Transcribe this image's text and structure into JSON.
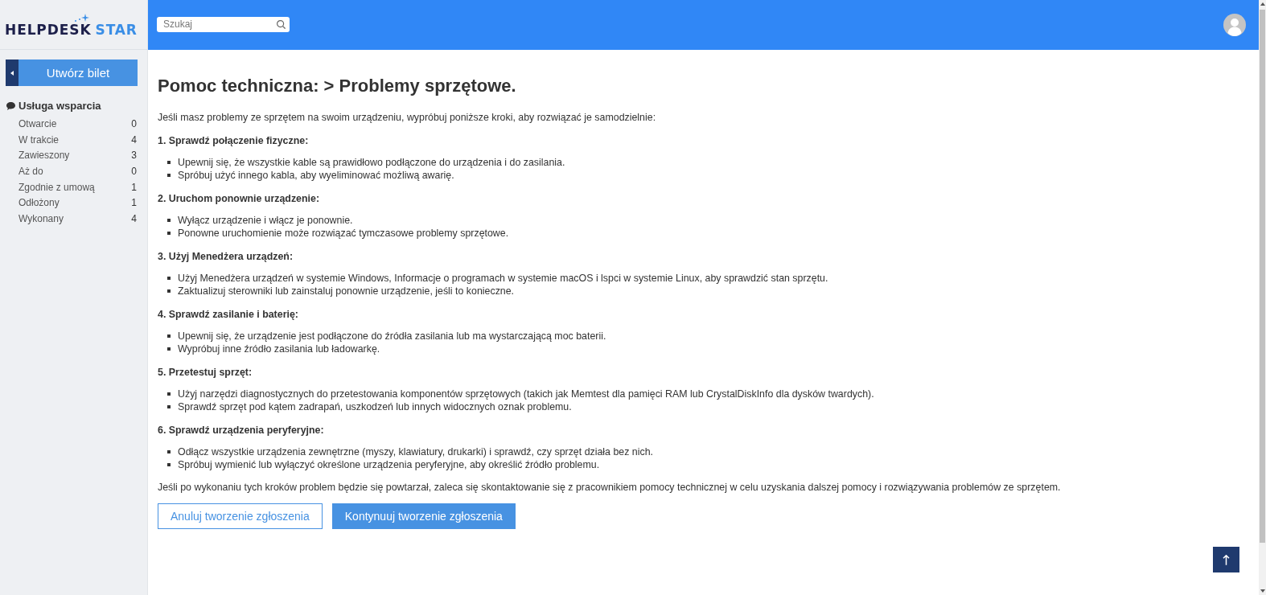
{
  "header": {
    "logo": {
      "name": "HELPDESK",
      "accent": "STAR"
    },
    "search": {
      "placeholder": "Szukaj"
    }
  },
  "sidebar": {
    "create_button": "Utwórz bilet",
    "section": {
      "title": "Usługa wsparcia",
      "items": [
        {
          "label": "Otwarcie",
          "count": "0",
          "selected": false
        },
        {
          "label": "W trakcie",
          "count": "4",
          "selected": false
        },
        {
          "label": "Zawieszony",
          "count": "3",
          "selected": false
        },
        {
          "label": "Aż do",
          "count": "0",
          "selected": false
        },
        {
          "label": "Zgodnie z umową",
          "count": "1",
          "selected": false
        },
        {
          "label": "Odłożony",
          "count": "1",
          "selected": false
        },
        {
          "label": "Wykonany",
          "count": "4",
          "selected": false
        }
      ]
    }
  },
  "content": {
    "title": "Pomoc techniczna: > Problemy sprzętowe.",
    "intro": "Jeśli masz problemy ze sprzętem na swoim urządzeniu, wypróbuj poniższe kroki, aby rozwiązać je samodzielnie:",
    "steps": [
      {
        "heading": "1. Sprawdź połączenie fizyczne:",
        "bullets": [
          "Upewnij się, że wszystkie kable są prawidłowo podłączone do urządzenia i do zasilania.",
          "Spróbuj użyć innego kabla, aby wyeliminować możliwą awarię."
        ]
      },
      {
        "heading": "2. Uruchom ponownie urządzenie:",
        "bullets": [
          "Wyłącz urządzenie i włącz je ponownie.",
          "Ponowne uruchomienie może rozwiązać tymczasowe problemy sprzętowe."
        ]
      },
      {
        "heading": "3. Użyj Menedżera urządzeń:",
        "bullets": [
          "Użyj Menedżera urządzeń w systemie Windows, Informacje o programach w systemie macOS i lspci w systemie Linux, aby sprawdzić stan sprzętu.",
          "Zaktualizuj sterowniki lub zainstaluj ponownie urządzenie, jeśli to konieczne."
        ]
      },
      {
        "heading": "4. Sprawdź zasilanie i baterię:",
        "bullets": [
          "Upewnij się, że urządzenie jest podłączone do źródła zasilania lub ma wystarczającą moc baterii.",
          "Wypróbuj inne źródło zasilania lub ładowarkę."
        ]
      },
      {
        "heading": "5. Przetestuj sprzęt:",
        "bullets": [
          "Użyj narzędzi diagnostycznych do przetestowania komponentów sprzętowych (takich jak Memtest dla pamięci RAM lub CrystalDiskInfo dla dysków twardych).",
          "Sprawdź sprzęt pod kątem zadrapań, uszkodzeń lub innych widocznych oznak problemu."
        ]
      },
      {
        "heading": "6. Sprawdź urządzenia peryferyjne:",
        "bullets": [
          "Odłącz wszystkie urządzenia zewnętrzne (myszy, klawiatury, drukarki) i sprawdź, czy sprzęt działa bez nich.",
          "Spróbuj wymienić lub wyłączyć określone urządzenia peryferyjne, aby określić źródło problemu."
        ]
      }
    ],
    "outro": "Jeśli po wykonaniu tych kroków problem będzie się powtarzał, zaleca się skontaktowanie się z pracownikiem pomocy technicznej w celu uzyskania dalszej pomocy i rozwiązywania problemów ze sprzętem.",
    "buttons": [
      {
        "label": "Anuluj tworzenie zgłoszenia",
        "kind": "outline"
      },
      {
        "label": "Kontynuuj tworzenie zgłoszenia",
        "kind": "primary"
      }
    ]
  }
}
